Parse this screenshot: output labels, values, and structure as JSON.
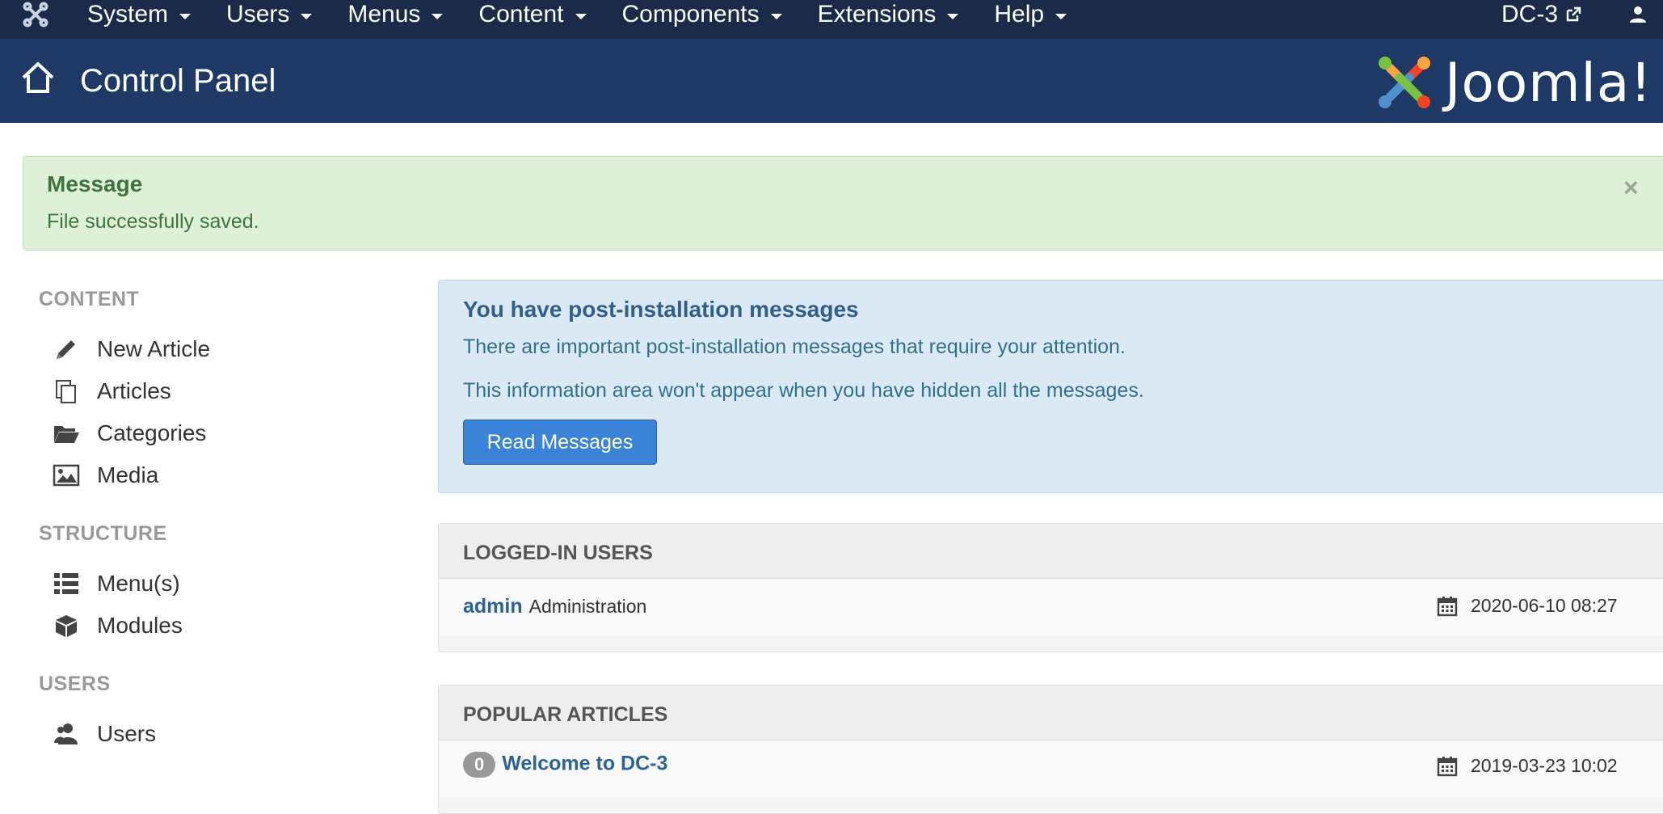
{
  "topnav": {
    "menus": [
      "System",
      "Users",
      "Menus",
      "Content",
      "Components",
      "Extensions",
      "Help"
    ],
    "site_name": "DC-3"
  },
  "header": {
    "title": "Control Panel",
    "brand": "Joomla!"
  },
  "alert": {
    "heading": "Message",
    "text": "File successfully saved.",
    "close": "×"
  },
  "sidebar": {
    "sections": [
      {
        "title": "CONTENT",
        "items": [
          "New Article",
          "Articles",
          "Categories",
          "Media"
        ]
      },
      {
        "title": "STRUCTURE",
        "items": [
          "Menu(s)",
          "Modules"
        ]
      },
      {
        "title": "USERS",
        "items": [
          "Users"
        ]
      }
    ]
  },
  "post_install": {
    "heading": "You have post-installation messages",
    "line1": "There are important post-installation messages that require your attention.",
    "line2": "This information area won't appear when you have hidden all the messages.",
    "button": "Read Messages"
  },
  "logged_in": {
    "title": "LOGGED-IN USERS",
    "rows": [
      {
        "name": "admin",
        "role": "Administration",
        "date": "2020-06-10 08:27"
      }
    ]
  },
  "popular": {
    "title": "POPULAR ARTICLES",
    "rows": [
      {
        "hits": "0",
        "title": "Welcome to DC-3",
        "date": "2019-03-23 10:02"
      }
    ]
  },
  "colors": {
    "topnav_bg": "#1a2a48",
    "header_bg": "#1f3967",
    "alert_bg": "#dff0d8",
    "info_bg": "#dbe9f5",
    "button_bg": "#3a83d6",
    "link": "#2a6496"
  }
}
